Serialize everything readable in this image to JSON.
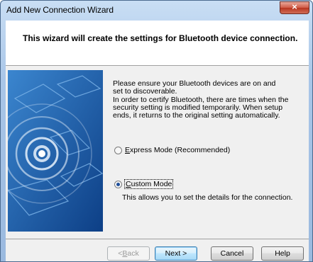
{
  "window": {
    "title": "Add New Connection Wizard"
  },
  "header": {
    "text": "This wizard will create the settings for Bluetooth device connection."
  },
  "content": {
    "paragraph1": "Please ensure your Bluetooth devices are on and set to discoverable.",
    "paragraph2": "In order to certify Bluetooth, there are times when the security setting is modified temporarily. When setup ends, it returns to the original setting automatically.",
    "options": [
      {
        "label": "Express Mode (Recommended)",
        "accelerator": "E",
        "rest": "xpress Mode (Recommended)",
        "selected": false
      },
      {
        "label": "Custom Mode",
        "accelerator": "C",
        "rest": "ustom Mode",
        "selected": true
      }
    ],
    "custom_description": "This allows you to set the details for the connection."
  },
  "buttons": {
    "back": {
      "pre": "< ",
      "acc": "B",
      "rest": "ack",
      "enabled": false
    },
    "next": "Next >",
    "cancel": "Cancel",
    "help": "Help"
  },
  "colors": {
    "accent": "#1f4f9a",
    "illustration": "#1b5aa6"
  },
  "icons": {
    "close": "close-icon",
    "illustration": "bluetooth-wave-illustration"
  }
}
